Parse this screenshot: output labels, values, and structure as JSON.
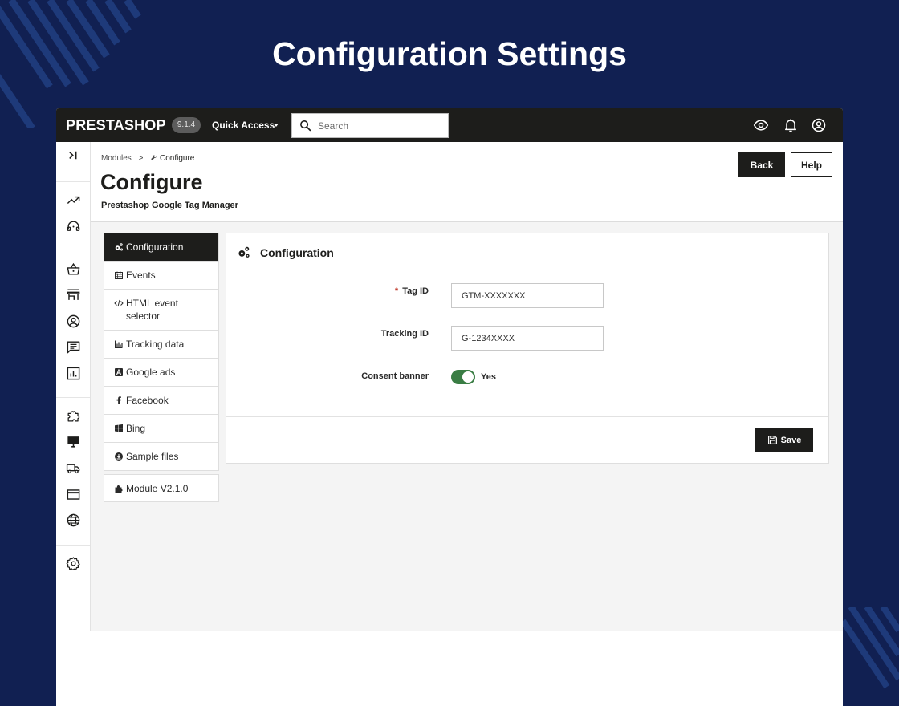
{
  "hero": {
    "title": "Configuration Settings"
  },
  "topbar": {
    "logo": "PRESTASHOP",
    "version": "9.1.4",
    "quick_access": "Quick Access",
    "search_placeholder": "Search"
  },
  "breadcrumb": {
    "parent": "Modules",
    "separator": ">",
    "current": "Configure"
  },
  "header": {
    "title": "Configure",
    "subtitle": "Prestashop Google Tag Manager",
    "back_label": "Back",
    "help_label": "Help"
  },
  "tabs": [
    {
      "label": "Configuration",
      "icon": "cogs-icon",
      "active": true
    },
    {
      "label": "Events",
      "icon": "calendar-icon"
    },
    {
      "label": "HTML event selector",
      "icon": "code-icon"
    },
    {
      "label": "Tracking data",
      "icon": "bar-chart-icon"
    },
    {
      "label": "Google ads",
      "icon": "google-ads-icon"
    },
    {
      "label": "Facebook",
      "icon": "facebook-icon"
    },
    {
      "label": "Bing",
      "icon": "windows-icon"
    },
    {
      "label": "Sample files",
      "icon": "download-circle-icon"
    }
  ],
  "module": {
    "label": "Module V2.1.0",
    "icon": "puzzle-icon"
  },
  "panel": {
    "title": "Configuration",
    "tag_id": {
      "label": "Tag ID",
      "required_mark": "*",
      "value": "GTM-XXXXXXX"
    },
    "tracking_id": {
      "label": "Tracking ID",
      "value": "G-1234XXXX"
    },
    "consent_banner": {
      "label": "Consent banner",
      "state": "Yes"
    },
    "save_label": "Save"
  },
  "colors": {
    "background": "#112052",
    "dark": "#1d1d1b",
    "toggle_on": "#3a7d44"
  }
}
